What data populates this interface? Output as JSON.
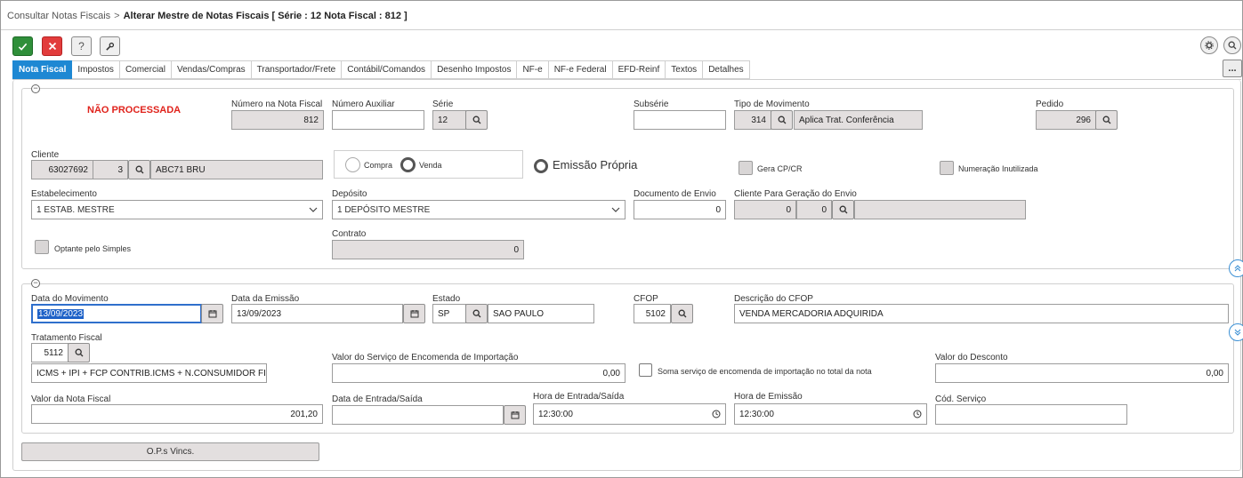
{
  "breadcrumb": {
    "parent": "Consultar Notas Fiscais",
    "separator": ">",
    "current": "Alterar Mestre de Notas Fiscais [ Série : 12 Nota Fiscal : 812 ]"
  },
  "toolbar": {
    "confirm_icon": "check-icon",
    "cancel_icon": "close-icon",
    "help_label": "?",
    "tools_icon": "wrench-icon",
    "settings_icon": "gear-icon",
    "search_icon": "search-icon",
    "more_label": "..."
  },
  "tabs": [
    {
      "label": "Nota Fiscal",
      "active": true
    },
    {
      "label": "Impostos"
    },
    {
      "label": "Comercial"
    },
    {
      "label": "Vendas/Compras"
    },
    {
      "label": "Transportador/Frete"
    },
    {
      "label": "Contábil/Comandos"
    },
    {
      "label": "Desenho Impostos"
    },
    {
      "label": "NF-e"
    },
    {
      "label": "NF-e Federal"
    },
    {
      "label": "EFD-Reinf"
    },
    {
      "label": "Textos"
    },
    {
      "label": "Detalhes"
    }
  ],
  "section1": {
    "status": "NÃO PROCESSADA",
    "numero_nf": {
      "label": "Número na Nota Fiscal",
      "value": "812"
    },
    "numero_aux": {
      "label": "Número Auxiliar",
      "value": ""
    },
    "serie": {
      "label": "Série",
      "value": "12"
    },
    "subserie": {
      "label": "Subsérie",
      "value": ""
    },
    "tipo_mov": {
      "label": "Tipo de Movimento",
      "code": "314",
      "desc": "Aplica Trat. Conferência"
    },
    "pedido": {
      "label": "Pedido",
      "value": "296"
    },
    "cliente": {
      "label": "Cliente",
      "code": "63027692",
      "sub": "3",
      "name": "ABC71 BRU"
    },
    "compra_label": "Compra",
    "venda_label": "Venda",
    "emissao_propria": "Emissão Própria",
    "gera_cpcr": "Gera CP/CR",
    "numeracao_inutilizada": "Numeração Inutilizada",
    "estabelecimento": {
      "label": "Estabelecimento",
      "value": "1 ESTAB. MESTRE"
    },
    "deposito": {
      "label": "Depósito",
      "value": "1 DEPÓSITO MESTRE"
    },
    "doc_envio": {
      "label": "Documento de Envio",
      "value": "0"
    },
    "cliente_envio": {
      "label": "Cliente Para Geração do Envio",
      "code": "0",
      "sub": "0",
      "name": ""
    },
    "optante": "Optante pelo Simples",
    "contrato": {
      "label": "Contrato",
      "value": "0"
    }
  },
  "section2": {
    "data_mov": {
      "label": "Data do Movimento",
      "value": "13/09/2023"
    },
    "data_emissao": {
      "label": "Data da Emissão",
      "value": "13/09/2023"
    },
    "estado": {
      "label": "Estado",
      "code": "SP",
      "name": "SAO PAULO"
    },
    "cfop": {
      "label": "CFOP",
      "value": "5102"
    },
    "desc_cfop": {
      "label": "Descrição do CFOP",
      "value": "VENDA MERCADORIA ADQUIRIDA"
    },
    "trat_fiscal": {
      "label": "Tratamento Fiscal",
      "code": "5112",
      "desc": "ICMS + IPI + FCP CONTRIB.ICMS + N.CONSUMIDOR FINAL"
    },
    "valor_servico": {
      "label": "Valor do Serviço de Encomenda de Importação",
      "value": "0,00"
    },
    "soma_servico": "Soma serviço de encomenda de importação no total da nota",
    "valor_desconto": {
      "label": "Valor do Desconto",
      "value": "0,00"
    },
    "valor_nf": {
      "label": "Valor da Nota Fiscal",
      "value": "201,20"
    },
    "data_entrada": {
      "label": "Data de Entrada/Saída",
      "value": ""
    },
    "hora_entrada": {
      "label": "Hora de Entrada/Saída",
      "value": "12:30:00"
    },
    "hora_emissao": {
      "label": "Hora de Emissão",
      "value": "12:30:00"
    },
    "cod_servico": {
      "label": "Cód. Serviço",
      "value": ""
    }
  },
  "ops_button": "O.P.s Vincs."
}
